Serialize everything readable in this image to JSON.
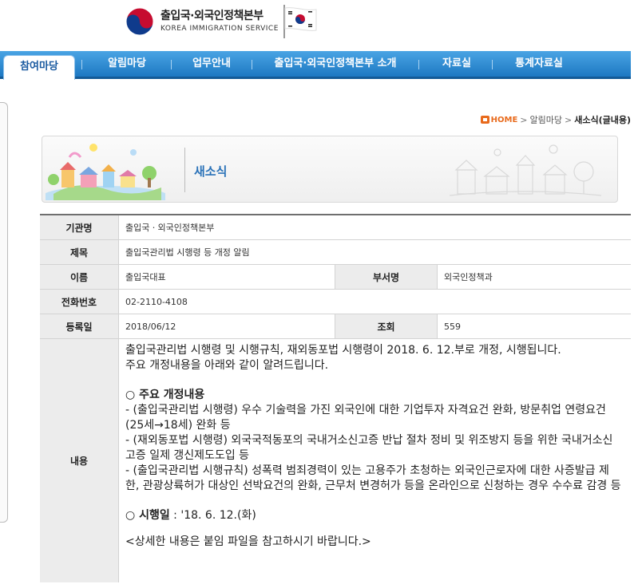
{
  "header": {
    "org_name": "출입국·외국인정책본부",
    "org_name_en": "KOREA IMMIGRATION SERVICE"
  },
  "nav": {
    "items": [
      {
        "label": "참여마당",
        "active": true
      },
      {
        "label": "알림마당",
        "active": false
      },
      {
        "label": "업무안내",
        "active": false
      },
      {
        "label": "출입국·외국인정책본부 소개",
        "active": false
      },
      {
        "label": "자료실",
        "active": false
      },
      {
        "label": "통계자료실",
        "active": false
      }
    ]
  },
  "breadcrumb": {
    "home": "HOME",
    "separator": ">",
    "level1": "알림마당",
    "current": "새소식(글내용)"
  },
  "banner": {
    "title": "새소식"
  },
  "detail": {
    "agency_label": "기관명",
    "agency_value": "출입국ㆍ외국인정책본부",
    "title_label": "제목",
    "title_value": "출입국관리법 시행령 등 개정 알림",
    "name_label": "이름",
    "name_value": "출입국대표",
    "dept_label": "부서명",
    "dept_value": "외국인정책과",
    "phone_label": "전화번호",
    "phone_value": "02-2110-4108",
    "date_label": "등록일",
    "date_value": "2018/06/12",
    "views_label": "조회",
    "views_value": "559",
    "content_label": "내용"
  },
  "content": {
    "intro_1": "출입국관리법 시행령 및 시행규칙, 재외동포법 시행령이 2018. 6. 12.부로 개정, 시행됩니다.",
    "intro_2": "주요 개정내용을 아래와 같이 알려드립니다.",
    "section_title": "○ 주요 개정내용",
    "bullet_1": "- (출입국관리법 시행령) 우수 기술력을 가진 외국인에 대한 기업투자 자격요건 완화, 방문취업 연령요건(25세→18세) 완화 등",
    "bullet_2": "- (재외동포법 시행령) 외국국적동포의 국내거소신고증 반납 절차 정비 및 위조방지 등을 위한 국내거소신고증 일제 갱신제도도입 등",
    "bullet_3": "- (출입국관리법 시행규칙) 성폭력 범죄경력이 있는 고용주가 초청하는 외국인근로자에 대한 사증발급 제한, 관광상륙허가 대상인 선박요건의 완화, 근무처 변경허가 등을 온라인으로 신청하는 경우 수수료 감경 등",
    "effective_prefix": "○  시행일",
    "effective_value": " : '18. 6. 12.(화)",
    "closing": "<상세한 내용은 붙임 파일을 참고하시기 바랍니다.>"
  },
  "colors": {
    "nav_blue": "#1d78c2",
    "accent_orange": "#e86a1c",
    "banner_title": "#2a72b8"
  },
  "icons": [
    "taegeuk-emblem-icon",
    "korean-flag-icon",
    "home-icon"
  ]
}
